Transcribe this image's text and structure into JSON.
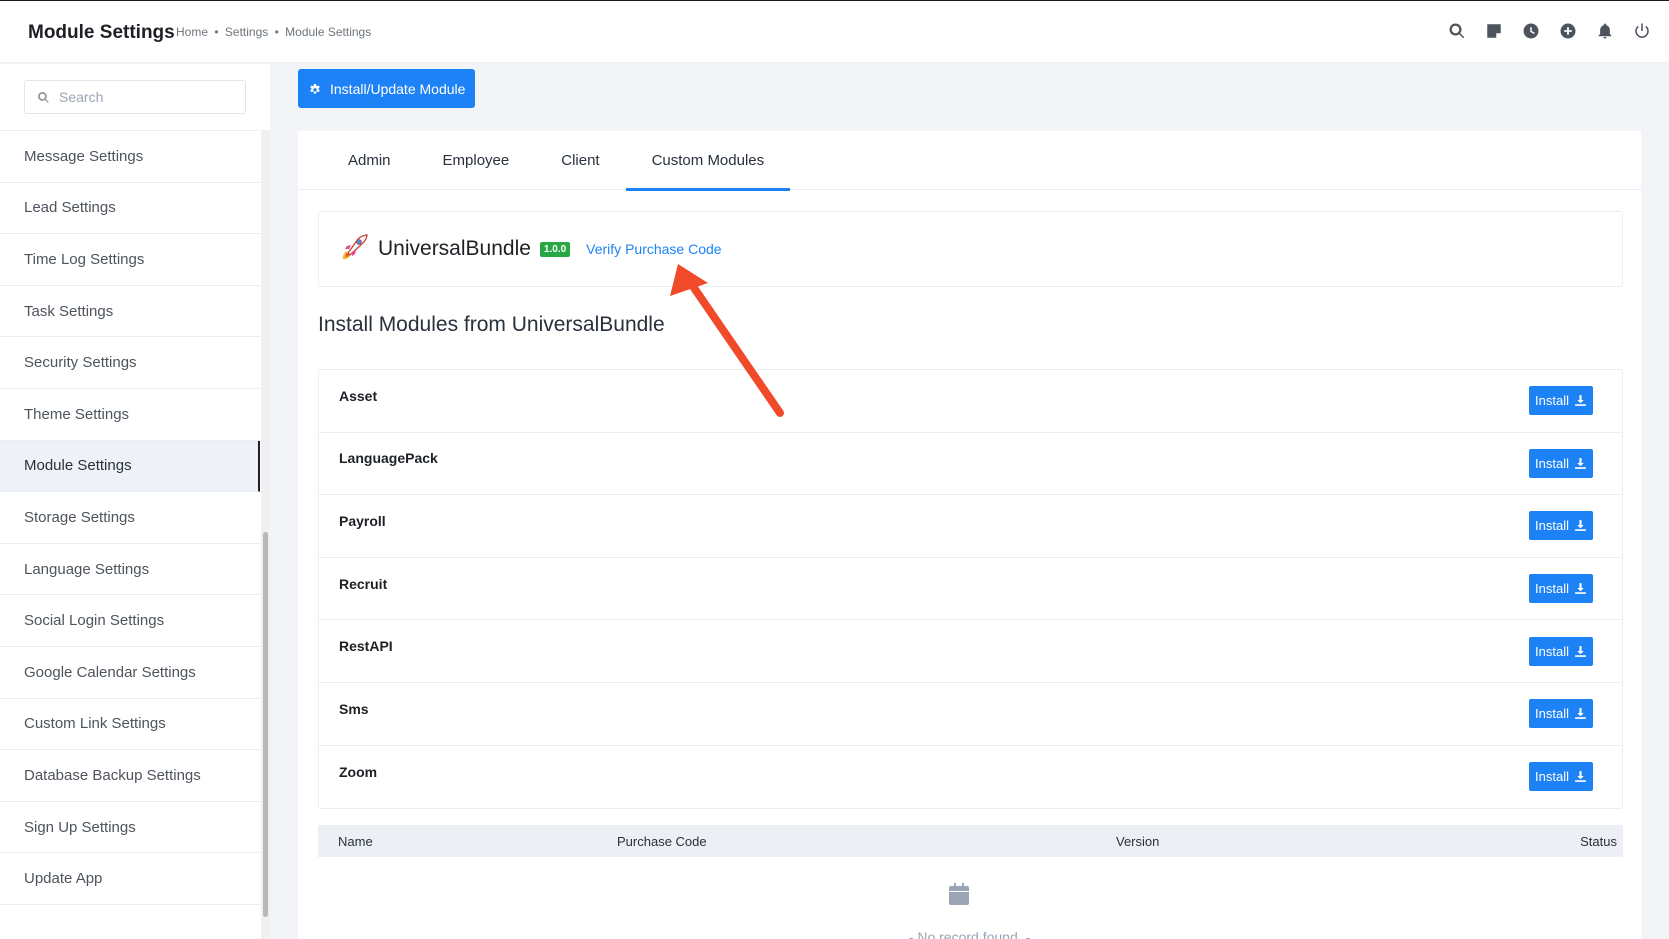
{
  "header": {
    "title": "Module Settings",
    "breadcrumb": [
      "Home",
      "Settings",
      "Module Settings"
    ],
    "breadcrumb_separator": "•",
    "icons": [
      "search-icon",
      "sticky-note-icon",
      "clock-icon",
      "add-circle-icon",
      "bell-icon",
      "power-icon"
    ]
  },
  "sidebar": {
    "search_placeholder": "Search",
    "items": [
      {
        "label": "Message Settings"
      },
      {
        "label": "Lead Settings"
      },
      {
        "label": "Time Log Settings"
      },
      {
        "label": "Task Settings"
      },
      {
        "label": "Security Settings"
      },
      {
        "label": "Theme Settings"
      },
      {
        "label": "Module Settings",
        "active": true
      },
      {
        "label": "Storage Settings"
      },
      {
        "label": "Language Settings"
      },
      {
        "label": "Social Login Settings"
      },
      {
        "label": "Google Calendar Settings"
      },
      {
        "label": "Custom Link Settings"
      },
      {
        "label": "Database Backup Settings"
      },
      {
        "label": "Sign Up Settings"
      },
      {
        "label": "Update App"
      }
    ]
  },
  "toolbar": {
    "install_update_label": "Install/Update Module"
  },
  "tabs": [
    {
      "label": "Admin"
    },
    {
      "label": "Employee"
    },
    {
      "label": "Client"
    },
    {
      "label": "Custom Modules",
      "active": true
    }
  ],
  "bundle": {
    "name": "UniversalBundle",
    "version": "1.0.0",
    "verify_label": "Verify Purchase Code"
  },
  "section_title": "Install Modules from UniversalBundle",
  "modules": [
    {
      "name": "Asset",
      "button": "Install"
    },
    {
      "name": "LanguagePack",
      "button": "Install"
    },
    {
      "name": "Payroll",
      "button": "Install"
    },
    {
      "name": "Recruit",
      "button": "Install"
    },
    {
      "name": "RestAPI",
      "button": "Install"
    },
    {
      "name": "Sms",
      "button": "Install"
    },
    {
      "name": "Zoom",
      "button": "Install"
    }
  ],
  "table": {
    "columns": [
      "Name",
      "Purchase Code",
      "Version",
      "Status"
    ],
    "empty_text": "- No record found. -"
  },
  "colors": {
    "accent": "#1d82f5",
    "badge": "#28a745",
    "annotation_arrow": "#f04a2a"
  }
}
